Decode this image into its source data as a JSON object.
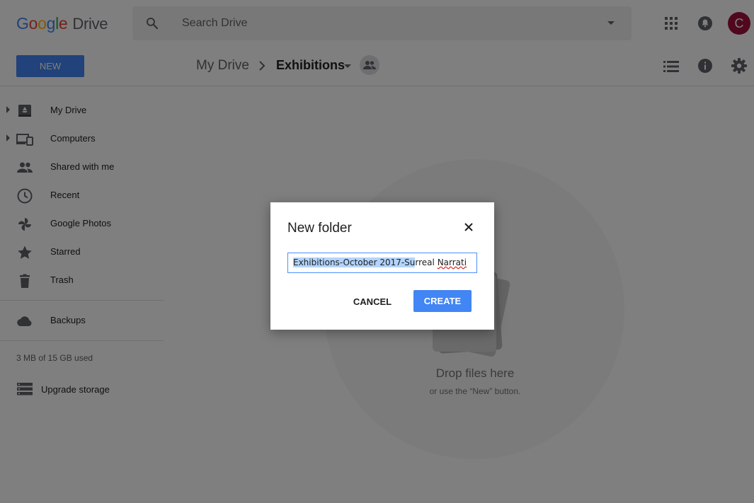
{
  "header": {
    "logo_google": [
      "G",
      "o",
      "o",
      "g",
      "l",
      "e"
    ],
    "logo_product": "Drive",
    "search_placeholder": "Search Drive",
    "avatar_initial": "C"
  },
  "toolbar": {
    "new_label": "NEW",
    "breadcrumb_root": "My Drive",
    "breadcrumb_current": "Exhibitions"
  },
  "sidebar": {
    "items": [
      {
        "label": "My Drive",
        "icon": "my-drive-icon"
      },
      {
        "label": "Computers",
        "icon": "computers-icon"
      },
      {
        "label": "Shared with me",
        "icon": "people-icon"
      },
      {
        "label": "Recent",
        "icon": "clock-icon"
      },
      {
        "label": "Google Photos",
        "icon": "pinwheel-icon"
      },
      {
        "label": "Starred",
        "icon": "star-icon"
      },
      {
        "label": "Trash",
        "icon": "trash-icon"
      },
      {
        "label": "Backups",
        "icon": "cloud-icon"
      }
    ],
    "storage_text": "3 MB of 15 GB used",
    "upgrade_label": "Upgrade storage"
  },
  "main": {
    "drop_title": "Drop files here",
    "drop_subtitle": "or use the “New” button."
  },
  "dialog": {
    "title": "New folder",
    "input_selected": "Exhibitions-October 2017-Su",
    "input_rest_1": "rreal ",
    "input_misspelled": "Narrati",
    "cancel_label": "CANCEL",
    "create_label": "CREATE"
  },
  "colors": {
    "accent": "#4285f4",
    "avatar": "#a0103c",
    "selection": "#b3d4fc"
  }
}
